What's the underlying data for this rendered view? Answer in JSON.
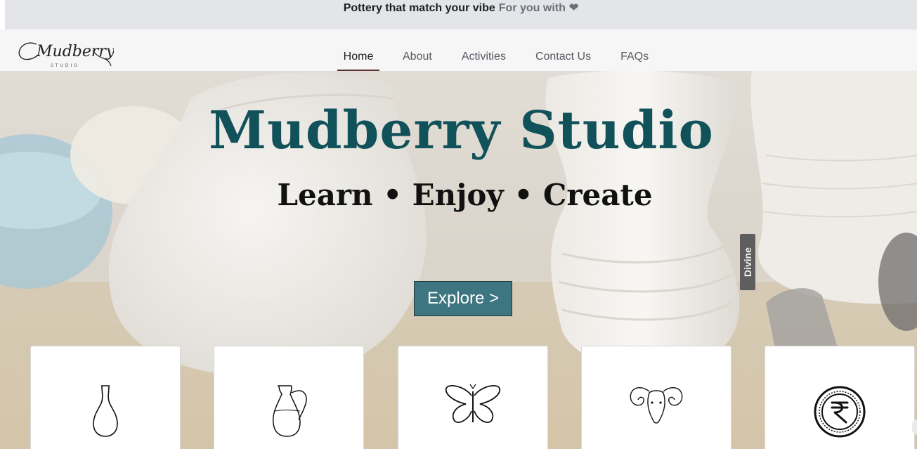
{
  "announcement": {
    "lead": "Pottery that match your vibe",
    "tail": "For you with",
    "heart_icon": "heart-icon"
  },
  "header": {
    "logo_text": "Mudberry",
    "logo_subtext": "STUDIO",
    "nav": [
      {
        "label": "Home",
        "active": true
      },
      {
        "label": "About",
        "active": false
      },
      {
        "label": "Activities",
        "active": false
      },
      {
        "label": "Contact Us",
        "active": false
      },
      {
        "label": "FAQs",
        "active": false
      }
    ]
  },
  "hero": {
    "title": "Mudberry Studio",
    "subtitle": "Learn • Enjoy • Create",
    "cta_label": "Explore >",
    "tag_text": "Divine"
  },
  "cards": [
    {
      "icon": "vase-icon"
    },
    {
      "icon": "jug-icon"
    },
    {
      "icon": "butterfly-icon"
    },
    {
      "icon": "ram-icon"
    },
    {
      "icon": "rupee-coin-icon"
    }
  ],
  "colors": {
    "title": "#11525a",
    "cta_bg": "#3d7580",
    "nav_active_underline": "#5a2f2f",
    "announcement_bg": "#e3e5e8"
  }
}
